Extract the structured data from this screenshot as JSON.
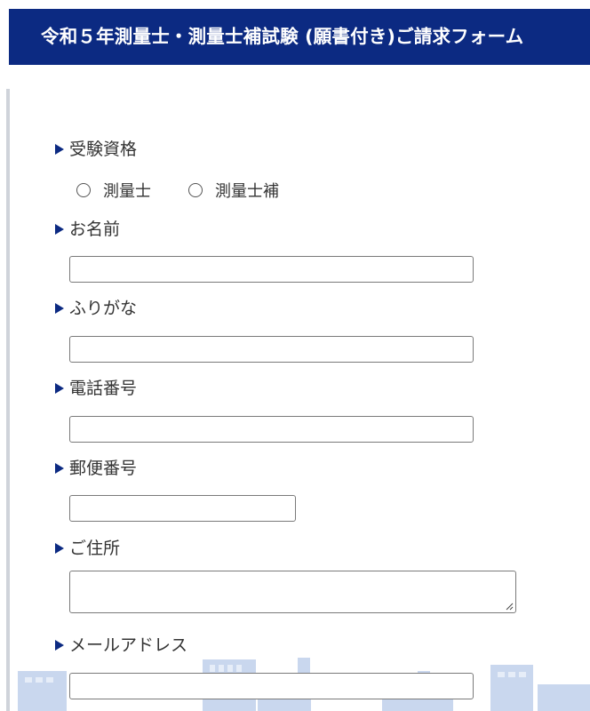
{
  "header": {
    "title": "令和５年測量士・測量士補試験 (願書付き)ご請求フォーム"
  },
  "form": {
    "qualification": {
      "label": "受験資格",
      "options": [
        "測量士",
        "測量士補"
      ]
    },
    "name": {
      "label": "お名前",
      "value": ""
    },
    "furigana": {
      "label": "ふりがな",
      "value": ""
    },
    "phone": {
      "label": "電話番号",
      "value": ""
    },
    "postal_code": {
      "label": "郵便番号",
      "value": ""
    },
    "address": {
      "label": "ご住所",
      "value": ""
    },
    "email": {
      "label": "メールアドレス",
      "value": ""
    }
  },
  "colors": {
    "header_bg": "#0c2a82",
    "accent": "#0c2a82",
    "bg_art": "#c9d7ee"
  }
}
